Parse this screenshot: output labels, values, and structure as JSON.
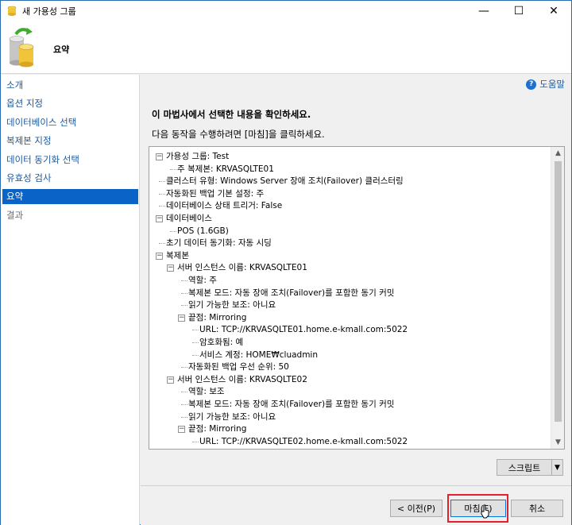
{
  "window": {
    "title": "새 가용성 그룹",
    "controls": [
      "—",
      "☐",
      "✕"
    ]
  },
  "header": {
    "title": "요약"
  },
  "sidebar": {
    "items": [
      {
        "label": "소개",
        "state": "link"
      },
      {
        "label": "옵션 지정",
        "state": "link"
      },
      {
        "label": "데이터베이스 선택",
        "state": "link"
      },
      {
        "label": "복제본 지정",
        "state": "link"
      },
      {
        "label": "데이터 동기화 선택",
        "state": "link"
      },
      {
        "label": "유효성 검사",
        "state": "link"
      },
      {
        "label": "요약",
        "state": "active"
      },
      {
        "label": "결과",
        "state": "disabled"
      }
    ]
  },
  "content": {
    "help_label": "도움말",
    "heading": "이 마법사에서 선택한 내용을 확인하세요.",
    "instruction": "다음 동작을 수행하려면 [마침]을 클릭하세요.",
    "tree": [
      {
        "text": "가용성 그룹: Test",
        "level": 0,
        "toggle": "-"
      },
      {
        "text": "주 복제본: KRVASQLTE01",
        "level": 1
      },
      {
        "text": "클러스터 유형: Windows Server 장애 조치(Failover) 클러스터링",
        "level": 0
      },
      {
        "text": "자동화된 백업 기본 설정: 주",
        "level": 0
      },
      {
        "text": "데이터베이스 상태 트리거: False",
        "level": 0
      },
      {
        "text": "데이터베이스",
        "level": 0,
        "toggle": "-"
      },
      {
        "text": "POS (1.6GB)",
        "level": 1
      },
      {
        "text": "초기 데이터 동기화: 자동 시딩",
        "level": 0
      },
      {
        "text": "복제본",
        "level": 0,
        "toggle": "-"
      },
      {
        "text": "서버 인스턴스 이름: KRVASQLTE01",
        "level": 1,
        "toggle": "-"
      },
      {
        "text": "역할: 주",
        "level": 2
      },
      {
        "text": "복제본 모드: 자동 장애 조치(Failover)를 포함한 동기 커밋",
        "level": 2
      },
      {
        "text": "읽기 가능한 보조: 아니요",
        "level": 2
      },
      {
        "text": "끝점: Mirroring",
        "level": 2,
        "toggle": "-"
      },
      {
        "text": "URL: TCP://KRVASQLTE01.home.e-kmall.com:5022",
        "level": 3
      },
      {
        "text": "암호화됨: 예",
        "level": 3
      },
      {
        "text": "서비스 계정: HOME₩cluadmin",
        "level": 3
      },
      {
        "text": "자동화된 백업 우선 순위: 50",
        "level": 2
      },
      {
        "text": "서버 인스턴스 이름: KRVASQLTE02",
        "level": 1,
        "toggle": "-"
      },
      {
        "text": "역할: 보조",
        "level": 2
      },
      {
        "text": "복제본 모드: 자동 장애 조치(Failover)를 포함한 동기 커밋",
        "level": 2
      },
      {
        "text": "읽기 가능한 보조: 아니요",
        "level": 2
      },
      {
        "text": "끝점: Mirroring",
        "level": 2,
        "toggle": "-"
      },
      {
        "text": "URL: TCP://KRVASQLTE02.home.e-kmall.com:5022",
        "level": 3
      }
    ],
    "script_label": "스크립트"
  },
  "buttons": {
    "back": "< 이전(P)",
    "finish": "마침(F)",
    "cancel": "취소"
  }
}
